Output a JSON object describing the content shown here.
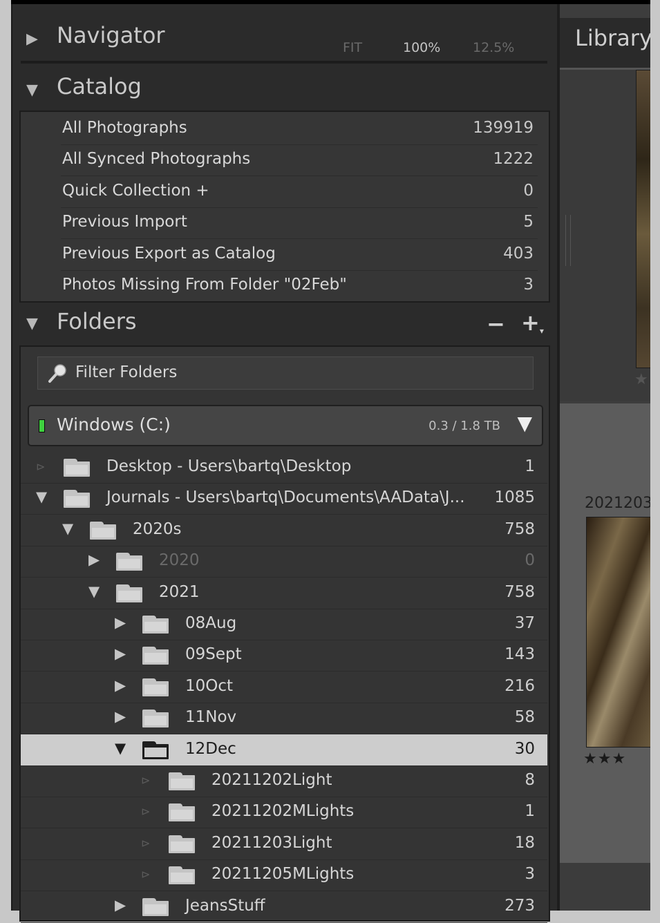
{
  "navigator": {
    "title": "Navigator",
    "zoom_fit": "FIT",
    "zoom_100": "100%",
    "zoom_125": "12.5%"
  },
  "catalog": {
    "title": "Catalog",
    "items": [
      {
        "label": "All Photographs",
        "count": "139919"
      },
      {
        "label": "All Synced Photographs",
        "count": "1222"
      },
      {
        "label": "Quick Collection  +",
        "count": "0"
      },
      {
        "label": "Previous Import",
        "count": "5"
      },
      {
        "label": "Previous Export as Catalog",
        "count": "403"
      },
      {
        "label": "Photos Missing From Folder \"02Feb\"",
        "count": "3"
      }
    ]
  },
  "folders": {
    "title": "Folders",
    "minus": "−",
    "plus": "+",
    "filter_placeholder": "Filter Folders",
    "volume": {
      "name": "Windows (C:)",
      "size": "0.3 / 1.8 TB"
    },
    "rows": [
      {
        "name": "Desktop - Users\\bartq\\Desktop",
        "count": "1",
        "expander": "⊳",
        "dim_exp": true
      },
      {
        "name": "Journals - Users\\bartq\\Documents\\AAData\\J...",
        "count": "1085",
        "expander": "▼"
      },
      {
        "name": "2020s",
        "count": "758",
        "expander": "▼"
      },
      {
        "name": "2020",
        "count": "0",
        "expander": "▶",
        "dim": true
      },
      {
        "name": "2021",
        "count": "758",
        "expander": "▼"
      },
      {
        "name": "08Aug",
        "count": "37",
        "expander": "▶"
      },
      {
        "name": "09Sept",
        "count": "143",
        "expander": "▶"
      },
      {
        "name": "10Oct",
        "count": "216",
        "expander": "▶"
      },
      {
        "name": "11Nov",
        "count": "58",
        "expander": "▶"
      },
      {
        "name": "12Dec",
        "count": "30",
        "expander": "▼",
        "selected": true
      },
      {
        "name": "20211202Light",
        "count": "8",
        "expander": "⊳",
        "dim_exp": true
      },
      {
        "name": "20211202MLights",
        "count": "1",
        "expander": "⊳",
        "dim_exp": true
      },
      {
        "name": "20211203Light",
        "count": "18",
        "expander": "⊳",
        "dim_exp": true
      },
      {
        "name": "20211205MLights",
        "count": "3",
        "expander": "⊳",
        "dim_exp": true
      },
      {
        "name": "JeansStuff",
        "count": "273",
        "expander": "▶"
      }
    ]
  },
  "library": {
    "title": "Library",
    "photo_caption": "2021203",
    "rating_stars": "★★★",
    "empty_star": "★"
  },
  "colors": {
    "panel_bg": "#2b2b2b",
    "selected_row_bg": "#cdcdcd",
    "volume_led": "#3fd23f"
  }
}
